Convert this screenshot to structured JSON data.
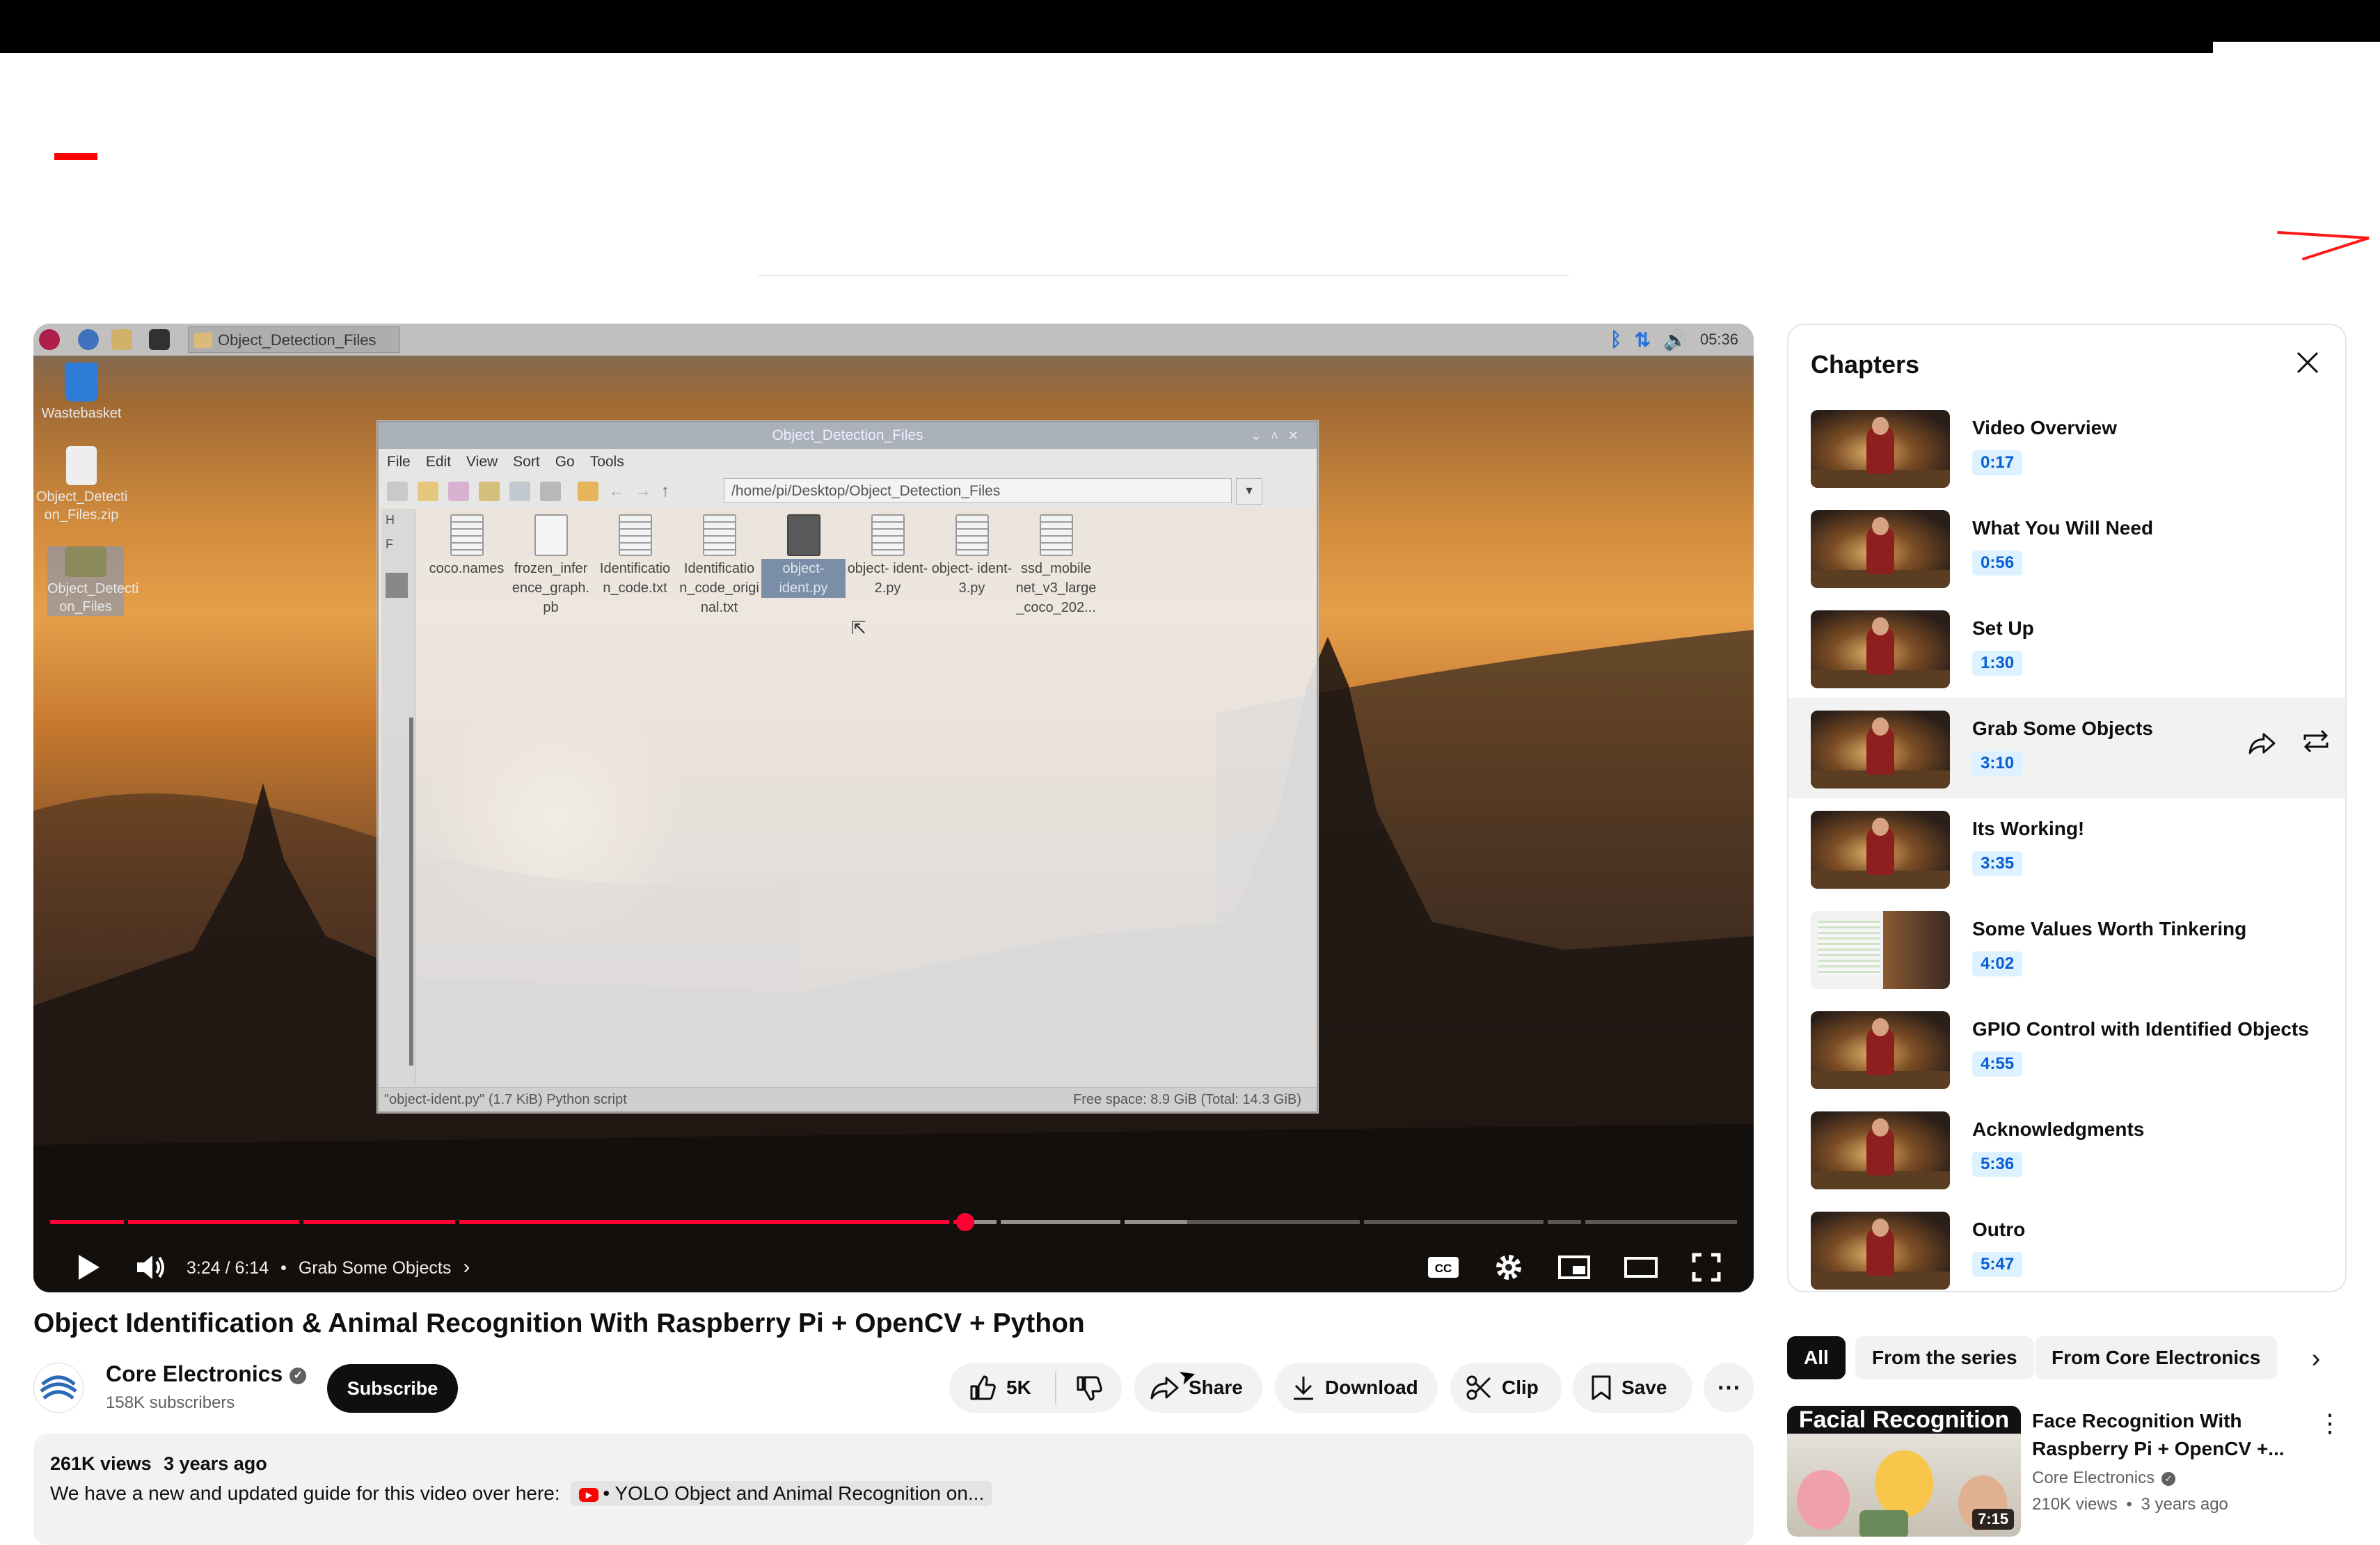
{
  "header": {
    "brand_color": "#ff0000"
  },
  "player": {
    "desktop": {
      "taskbar_folder": "Object_Detection_Files",
      "clock": "05:36",
      "icons": [
        {
          "label": "Wastebasket",
          "icon": "trash-icon"
        },
        {
          "label": "Object_Detecti on_Files.zip",
          "icon": "zip-icon"
        },
        {
          "label": "Object_Detecti on_Files",
          "icon": "folder-icon"
        }
      ]
    },
    "file_manager": {
      "title": "Object_Detection_Files",
      "menu": [
        "File",
        "Edit",
        "View",
        "Sort",
        "Go",
        "Tools"
      ],
      "path": "/home/pi/Desktop/Object_Detection_Files",
      "sidebar_labels": [
        "H",
        "F"
      ],
      "files": [
        {
          "name": "coco.names",
          "selected": false
        },
        {
          "name": "frozen_infer ence_graph. pb",
          "selected": false
        },
        {
          "name": "Identificatio n_code.txt",
          "selected": false
        },
        {
          "name": "Identificatio n_code_origi nal.txt",
          "selected": false
        },
        {
          "name": "object- ident.py",
          "selected": true
        },
        {
          "name": "object- ident-2.py",
          "selected": false
        },
        {
          "name": "object- ident-3.py",
          "selected": false
        },
        {
          "name": "ssd_mobile net_v3_large _coco_202...",
          "selected": false
        }
      ],
      "status_left": "\"object-ident.py\" (1.7 KiB) Python script",
      "status_right": "Free space: 8.9 GiB (Total: 14.3 GiB)"
    },
    "current_time": "3:24",
    "duration": "6:14",
    "time_display": "3:24 / 6:14",
    "chapter_display": "Grab Some Objects",
    "progress_fraction": 0.545,
    "play_icon": "play-icon",
    "accent_color": "#ff0033"
  },
  "video": {
    "title": "Object Identification & Animal Recognition With Raspberry Pi + OpenCV + Python",
    "channel": {
      "name": "Core Electronics",
      "subscribers": "158K subscribers",
      "subscribe_label": "Subscribe"
    },
    "actions": {
      "likes": "5K",
      "share": "Share",
      "download": "Download",
      "clip": "Clip",
      "save": "Save",
      "more": "⋯"
    },
    "description": {
      "views": "261K views",
      "age": "3 years ago",
      "text": "We have a new and updated guide for this video over here:",
      "link_text": "• YOLO Object and Animal Recognition on..."
    }
  },
  "chapters": {
    "title": "Chapters",
    "items": [
      {
        "name": "Video Overview",
        "time": "0:17",
        "active": false
      },
      {
        "name": "What You Will Need",
        "time": "0:56",
        "active": false
      },
      {
        "name": "Set Up",
        "time": "1:30",
        "active": false
      },
      {
        "name": "Grab Some Objects",
        "time": "3:10",
        "active": true
      },
      {
        "name": "Its Working!",
        "time": "3:35",
        "active": false
      },
      {
        "name": "Some Values Worth Tinkering",
        "time": "4:02",
        "active": false
      },
      {
        "name": "GPIO Control with Identified Objects",
        "time": "4:55",
        "active": false
      },
      {
        "name": "Acknowledgments",
        "time": "5:36",
        "active": false
      },
      {
        "name": "Outro",
        "time": "5:47",
        "active": false
      }
    ]
  },
  "related": {
    "chips": [
      "All",
      "From the series",
      "From Core Electronics"
    ],
    "selected_chip": "All",
    "items": [
      {
        "thumb_title": "Facial Recognition",
        "title": "Face Recognition With Raspberry Pi + OpenCV +...",
        "channel": "Core Electronics",
        "views": "210K views",
        "age": "3 years ago",
        "duration": "7:15"
      }
    ]
  }
}
